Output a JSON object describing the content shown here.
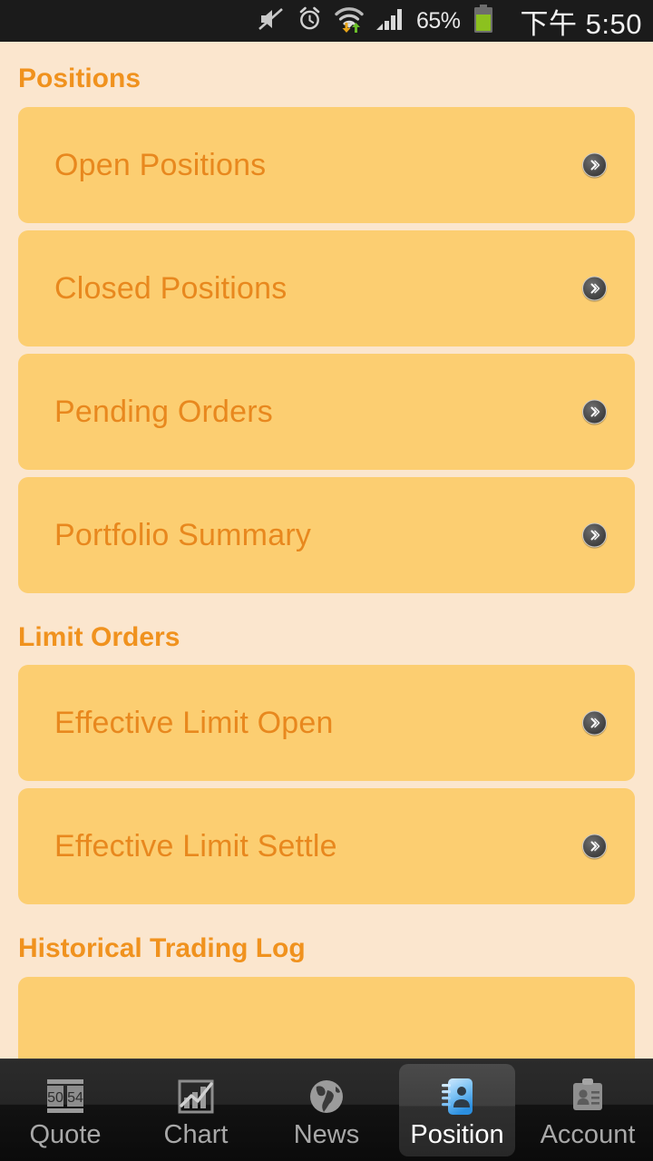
{
  "statusbar": {
    "icons": [
      "mute-icon",
      "alarm-icon",
      "wifi-data-icon",
      "signal-icon"
    ],
    "battery_percent": "65%",
    "battery_level": 65,
    "time": "下午 5:50"
  },
  "colors": {
    "page_background": "#FBE6CE",
    "card_background": "#FCCE71",
    "section_header_text": "#F0921E",
    "card_label_text": "#E8881E",
    "statusbar_background": "#1B1B1B",
    "tabbar_background": "#1A1A1A",
    "tab_selected_text": "#FFFFFF",
    "tab_text": "#A8A8A8",
    "battery_green": "#8CC11F",
    "data_up_arrow": "#6BBF2A",
    "data_down_arrow": "#E8A417"
  },
  "sections": [
    {
      "title": "Positions",
      "items": [
        {
          "label": "Open Positions",
          "name": "list-item-open-positions"
        },
        {
          "label": "Closed Positions",
          "name": "list-item-closed-positions"
        },
        {
          "label": "Pending Orders",
          "name": "list-item-pending-orders"
        },
        {
          "label": "Portfolio Summary",
          "name": "list-item-portfolio-summary"
        }
      ]
    },
    {
      "title": "Limit Orders",
      "items": [
        {
          "label": "Effective Limit Open",
          "name": "list-item-effective-limit-open"
        },
        {
          "label": "Effective Limit Settle",
          "name": "list-item-effective-limit-settle"
        }
      ]
    },
    {
      "title": "Historical Trading Log",
      "items": [
        {
          "label": "",
          "name": "list-item-historical-partial"
        }
      ]
    }
  ],
  "tabbar": {
    "tabs": [
      {
        "label": "Quote",
        "icon": "quote-board-icon",
        "selected": false
      },
      {
        "label": "Chart",
        "icon": "bar-chart-icon",
        "selected": false
      },
      {
        "label": "News",
        "icon": "globe-icon",
        "selected": false
      },
      {
        "label": "Position",
        "icon": "contact-book-icon",
        "selected": true
      },
      {
        "label": "Account",
        "icon": "id-badge-icon",
        "selected": false
      }
    ]
  },
  "quote_icon_numbers": {
    "left": "50",
    "right": "54"
  }
}
